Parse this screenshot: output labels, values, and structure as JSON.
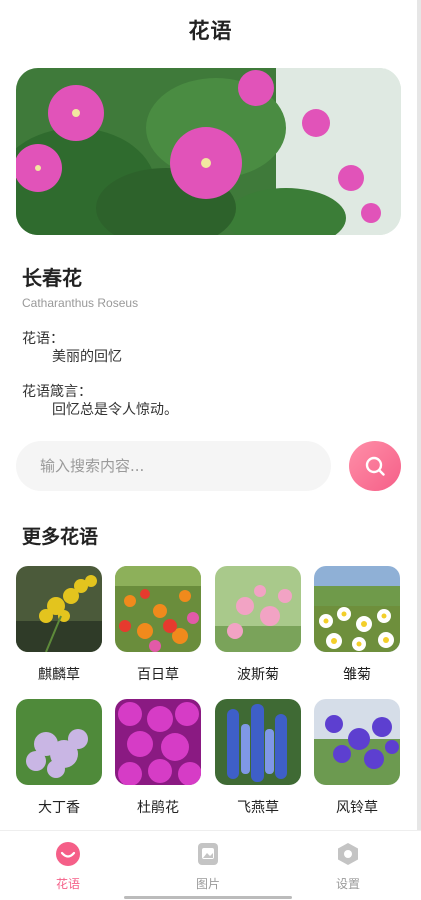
{
  "header": {
    "title": "花语"
  },
  "flower": {
    "name": "长春花",
    "latin": "Catharanthus Roseus",
    "meaning_label": "花语：",
    "meaning": "美丽的回忆",
    "quote_label": "花语箴言：",
    "quote": "回忆总是令人惊动。"
  },
  "search": {
    "placeholder": "输入搜索内容..."
  },
  "more": {
    "title": "更多花语",
    "items": [
      {
        "label": "麒麟草"
      },
      {
        "label": "百日草"
      },
      {
        "label": "波斯菊"
      },
      {
        "label": "雏菊"
      },
      {
        "label": "大丁香"
      },
      {
        "label": "杜鹃花"
      },
      {
        "label": "飞燕草"
      },
      {
        "label": "风铃草"
      }
    ]
  },
  "tabbar": {
    "items": [
      {
        "label": "花语",
        "icon": "flower-smile-icon",
        "active": true
      },
      {
        "label": "图片",
        "icon": "image-icon",
        "active": false
      },
      {
        "label": "设置",
        "icon": "settings-hex-icon",
        "active": false
      }
    ]
  },
  "colors": {
    "accent": "#f55f88",
    "muted": "#9a9a9a"
  }
}
